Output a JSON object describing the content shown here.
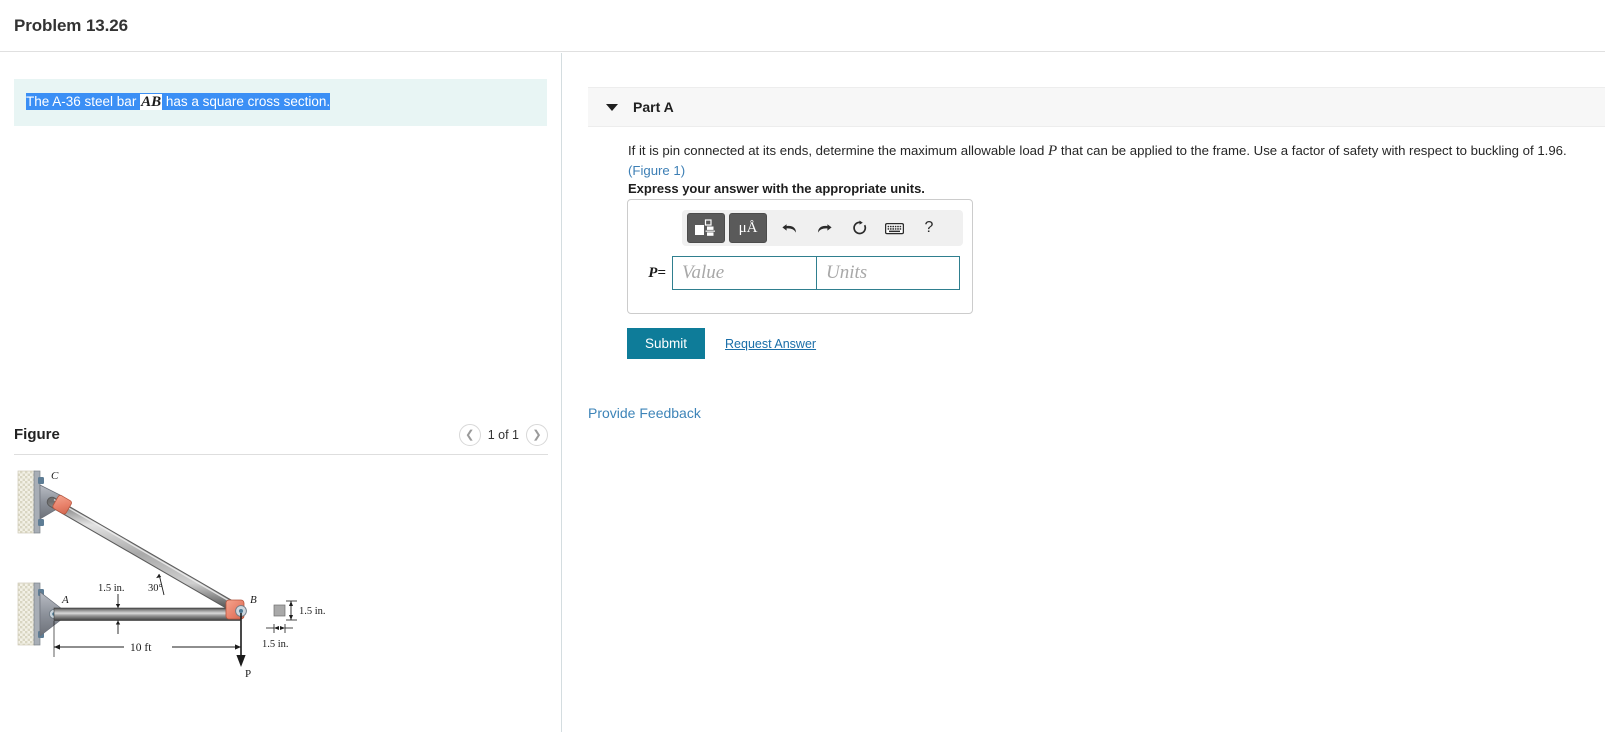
{
  "header": {
    "problem_title": "Problem 13.26"
  },
  "statement": {
    "prefix": "The A-36 steel bar ",
    "variable": "AB",
    "suffix": " has a square cross section."
  },
  "figure_panel": {
    "label": "Figure",
    "count_text": "1 of 1",
    "prev_icon": "chevron-left-icon",
    "next_icon": "chevron-right-icon"
  },
  "part_a": {
    "title": "Part A",
    "caret_icon": "caret-down-icon",
    "question_part1": "If it is pin connected at its ends, determine the maximum allowable load ",
    "question_var": "P",
    "question_part2": " that can be applied to the frame. Use a factor of safety with respect to buckling of 1.96. ",
    "figure_link": "(Figure 1)",
    "express_note": "Express your answer with the appropriate units."
  },
  "answer": {
    "toolbar": {
      "template_icon": "math-template-icon",
      "units_label": "μÅ",
      "units_icon": "units-icon",
      "undo_icon": "undo-icon",
      "redo_icon": "redo-icon",
      "reset_icon": "reset-icon",
      "keyboard_icon": "keyboard-icon",
      "help_icon": "help-icon",
      "help_label": "?"
    },
    "p_label": "P",
    "equals": "=",
    "value_placeholder": "Value",
    "value_text": "",
    "units_placeholder": "Units",
    "units_text": ""
  },
  "actions": {
    "submit_label": "Submit",
    "request_answer_label": "Request Answer",
    "provide_feedback_label": "Provide Feedback"
  },
  "colors": {
    "accent_teal": "#0e7c99",
    "link_blue": "#3d84b8",
    "highlight_blue": "#3b8ff5",
    "statement_bg": "#e8f5f4",
    "field_border": "#2f7f8f"
  },
  "figure_data": {
    "points": {
      "a_label": "A",
      "b_label": "B",
      "c_label": "C",
      "load_label": "P"
    },
    "dimensions": {
      "span": "10 ft",
      "angle": "30°",
      "bar_depth": "1.5 in.",
      "section_height": "1.5 in.",
      "section_width": "1.5 in."
    }
  }
}
